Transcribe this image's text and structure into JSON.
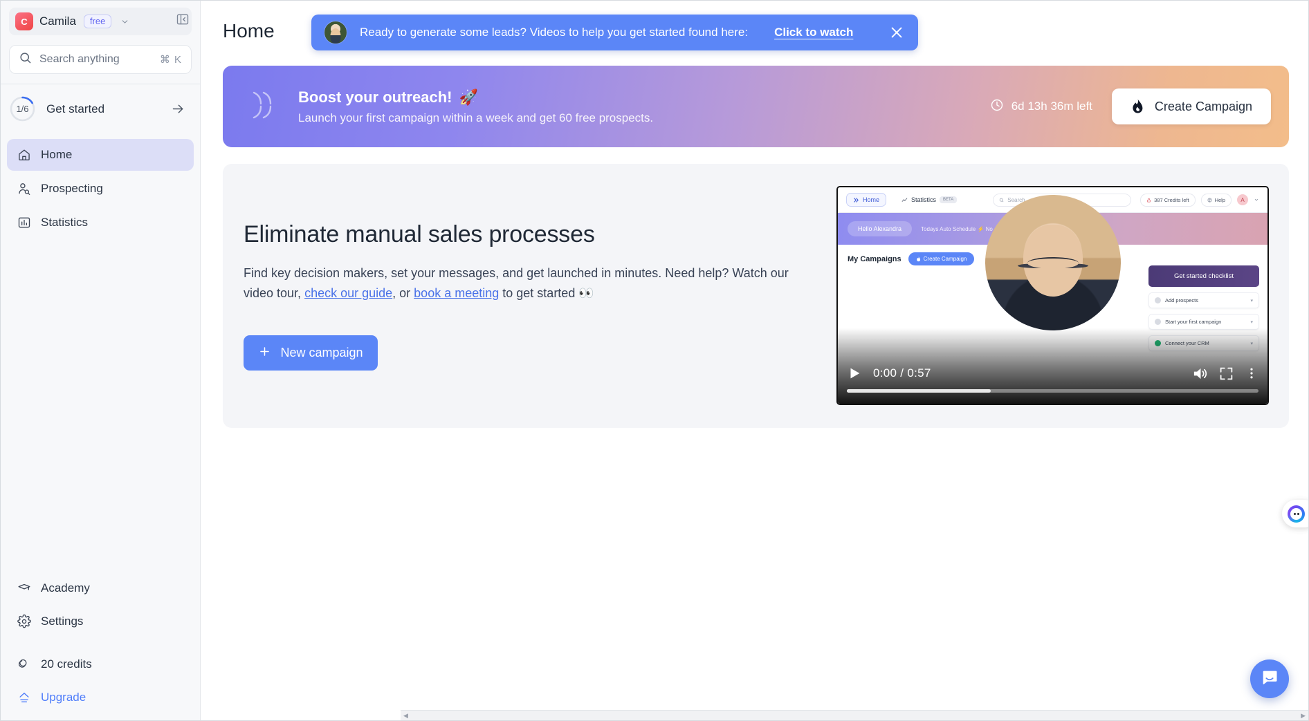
{
  "sidebar": {
    "workspace": {
      "initial": "C",
      "name": "Camila",
      "plan_badge": "free"
    },
    "collapse_icon": "panel-collapse-icon",
    "search": {
      "placeholder": "Search anything",
      "shortcut": "⌘ K"
    },
    "get_started": {
      "progress_label": "1/6",
      "label": "Get started",
      "progress_value": 16.7
    },
    "nav": [
      {
        "label": "Home",
        "icon": "home-icon",
        "active": true
      },
      {
        "label": "Prospecting",
        "icon": "person-search-icon",
        "active": false
      },
      {
        "label": "Statistics",
        "icon": "bar-chart-icon",
        "active": false
      }
    ],
    "bottom_nav": [
      {
        "label": "Academy",
        "icon": "graduation-cap-icon"
      },
      {
        "label": "Settings",
        "icon": "gear-icon"
      },
      {
        "label": "20 credits",
        "icon": "coins-icon"
      },
      {
        "label": "Upgrade",
        "icon": "upgrade-arrow-icon"
      }
    ]
  },
  "header": {
    "title": "Home"
  },
  "toast": {
    "avatar": "presenter-avatar",
    "message": "Ready to generate some leads? Videos to help you get started found here:",
    "link_label": "Click to watch",
    "close_icon": "close-icon"
  },
  "promo": {
    "title": "Boost your outreach!",
    "title_emoji": "🚀",
    "subtitle": "Launch your first campaign within a week and get 60 free prospects.",
    "timer": "6d 13h 36m left",
    "timer_icon": "clock-icon",
    "button_label": "Create Campaign",
    "button_icon": "flame-icon"
  },
  "hero": {
    "heading": "Eliminate manual sales processes",
    "paragraph_1": "Find key decision makers, set your messages, and get launched in minutes. Need help? Watch",
    "paragraph_2_pre": "our video tour, ",
    "link_guide": "check our guide",
    "paragraph_2_mid": ", or ",
    "link_meeting": "book a meeting",
    "paragraph_2_post": " to get started ",
    "paragraph_emoji": "👀",
    "cta_label": "New campaign",
    "cta_icon": "plus-icon"
  },
  "video": {
    "current_time": "0:00",
    "duration": "0:57",
    "time_display": "0:00 / 0:57",
    "play_icon": "play-icon",
    "volume_icon": "volume-icon",
    "fullscreen_icon": "fullscreen-icon",
    "more_icon": "more-vertical-icon",
    "progress_percent": 35,
    "thumbnail": {
      "nav_home": "Home",
      "nav_statistics": "Statistics",
      "nav_statistics_badge": "BETA",
      "search_placeholder": "Search...",
      "credits_chip": "387 Credits left",
      "help_chip": "Help",
      "avatar_letter": "A",
      "greeting": "Hello Alexandra",
      "band_text": "Todays Auto Schedule  ⚡  No a...",
      "campaigns_label": "My Campaigns",
      "create_campaign_label": "Create Campaign",
      "checklist_title": "Get started checklist",
      "checklist_items": [
        {
          "label": "Add prospects",
          "done": false
        },
        {
          "label": "Start your first campaign",
          "done": false
        },
        {
          "label": "Connect your CRM",
          "done": true
        }
      ]
    }
  },
  "floating": {
    "intercom_icon": "chat-bubble-icon",
    "side_widget_icon": "brand-orb-icon"
  },
  "colors": {
    "accent_blue": "#5b86f7",
    "sidebar_bg": "#f7f8fa",
    "active_nav": "#dcdef7",
    "link": "#4a72e8",
    "upgrade": "#4f7dfa"
  }
}
